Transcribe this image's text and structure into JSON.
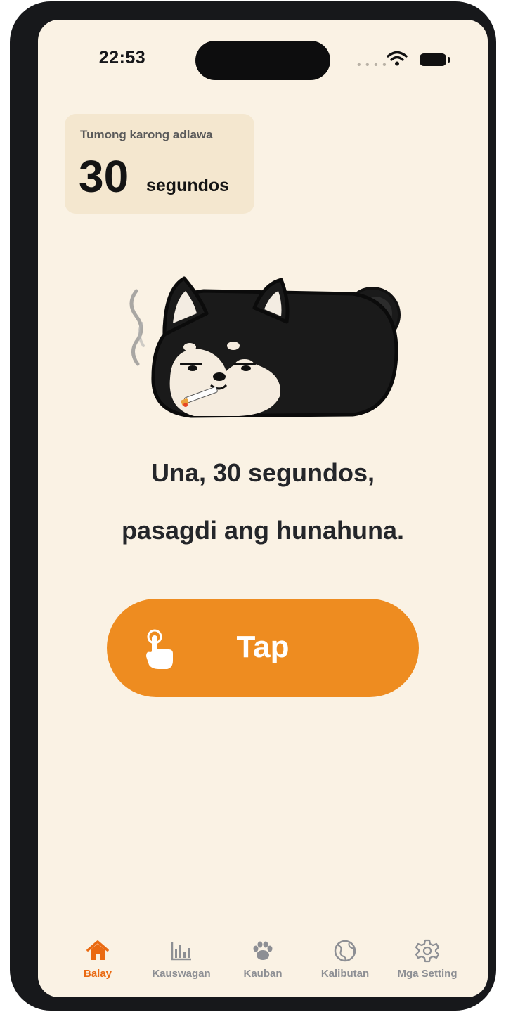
{
  "status_bar": {
    "time": "22:53",
    "signal_icon": "signal-dots-icon",
    "wifi_icon": "wifi-icon",
    "battery_icon": "battery-icon"
  },
  "streak_card": {
    "label": "Tumong karong adlawa",
    "value": "30",
    "unit": "segundos"
  },
  "mascot": {
    "icon": "smoking-shiba-dog-mascot"
  },
  "message": {
    "line1": "Una, 30 segundos,",
    "line2": "pasagdi ang hunahuna."
  },
  "tap_button": {
    "label": "Tap",
    "icon": "pointing-hand-icon",
    "color": "#ee8c20"
  },
  "tab_bar": {
    "active_color": "#ea6a12",
    "inactive_color": "#8d8f94",
    "tabs": [
      {
        "label": "Balay",
        "icon": "home-icon",
        "active": true
      },
      {
        "label": "Kauswagan",
        "icon": "bar-chart-icon",
        "active": false
      },
      {
        "label": "Kauban",
        "icon": "paw-icon",
        "active": false
      },
      {
        "label": "Kalibutan",
        "icon": "globe-icon",
        "active": false
      },
      {
        "label": "Mga Setting",
        "icon": "gear-icon",
        "active": false
      }
    ]
  }
}
